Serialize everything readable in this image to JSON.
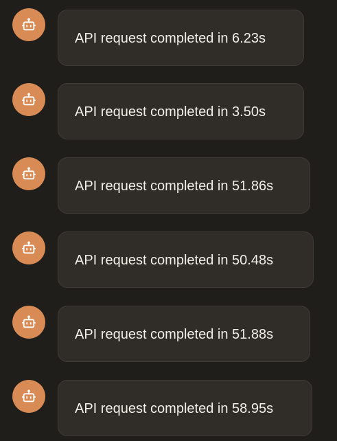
{
  "messages": [
    {
      "avatar_icon": "robot-icon",
      "text": "API request completed in 6.23s"
    },
    {
      "avatar_icon": "robot-icon",
      "text": "API request completed in 3.50s"
    },
    {
      "avatar_icon": "robot-icon",
      "text": "API request completed in 51.86s"
    },
    {
      "avatar_icon": "robot-icon",
      "text": "API request completed in 50.48s"
    },
    {
      "avatar_icon": "robot-icon",
      "text": "API request completed in 51.88s"
    },
    {
      "avatar_icon": "robot-icon",
      "text": "API request completed in 58.95s"
    }
  ],
  "colors": {
    "background": "#201e1b",
    "avatar": "#d98b55",
    "bubble": "#302d29",
    "bubble_border": "#3f3b36",
    "text": "#f1ede7"
  }
}
